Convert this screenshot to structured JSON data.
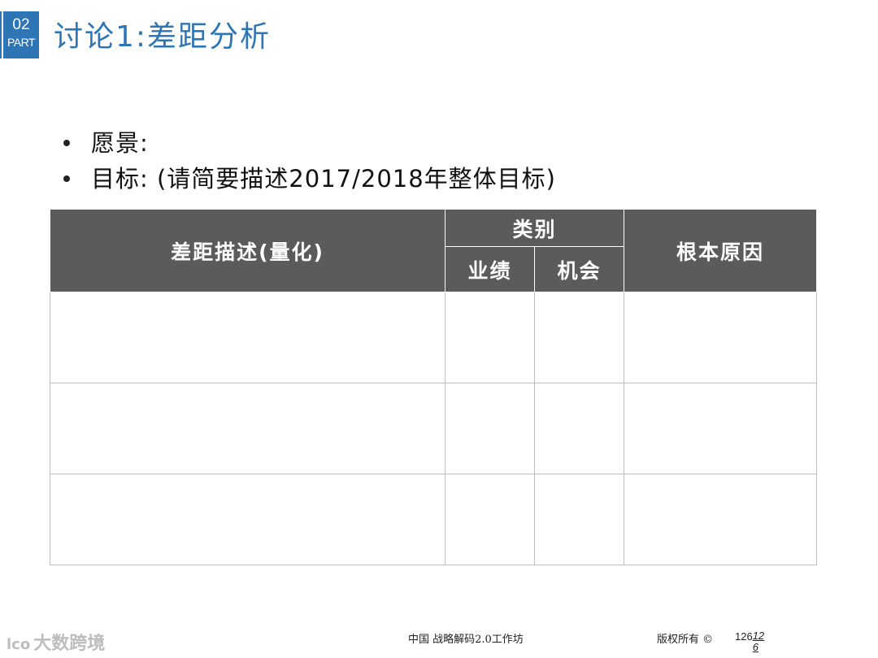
{
  "badge": {
    "number": "02",
    "label": "PART"
  },
  "title": "讨论1:差距分析",
  "bullets": [
    {
      "text": "愿景:"
    },
    {
      "text": "目标: (请简要描述2017/2018年整体目标)"
    }
  ],
  "table": {
    "headers": {
      "gap_description": "差距描述(量化)",
      "category": "类别",
      "category_sub": [
        "业绩",
        "机会"
      ],
      "root_cause": "根本原因"
    },
    "rows": [
      [
        "",
        "",
        "",
        ""
      ],
      [
        "",
        "",
        "",
        ""
      ],
      [
        "",
        "",
        "",
        ""
      ]
    ]
  },
  "footer": {
    "left": "中国  战略解码2.0工作坊",
    "right": "版权所有 ©",
    "page_a": "126",
    "page_b": "12",
    "page_c": "6"
  },
  "watermark": {
    "logo": "lco",
    "text": "大数跨境"
  },
  "colors": {
    "accent": "#2e75b6",
    "header_bg": "#5b5b5b",
    "grid": "#bfbfbf"
  }
}
